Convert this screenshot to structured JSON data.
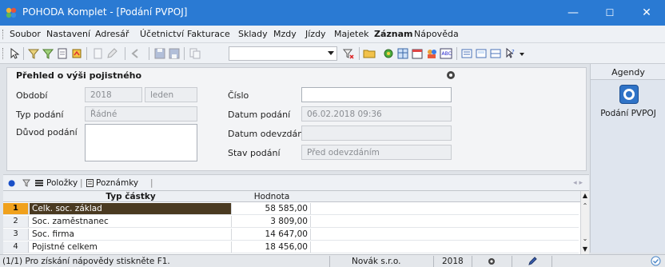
{
  "window": {
    "title": "POHODA Komplet - [Podání PVPOJ]",
    "minimize": "—",
    "maximize": "☐",
    "close": "✕"
  },
  "menu": {
    "items": [
      "Soubor",
      "Nastavení",
      "Adresář",
      "Účetnictví",
      "Fakturace",
      "Sklady",
      "Mzdy",
      "Jízdy",
      "Majetek",
      "Záznam",
      "Nápověda"
    ]
  },
  "form": {
    "title": "Přehled o výši pojistného",
    "obdobi_label": "Období",
    "obdobi_year": "2018",
    "obdobi_month": "leden",
    "typ_label": "Typ podání",
    "typ_value": "Řádné",
    "duvod_label": "Důvod podání",
    "duvod_value": "",
    "cislo_label": "Číslo",
    "cislo_value": "",
    "datum_podani_label": "Datum podání",
    "datum_podani_value": "06.02.2018 09:36",
    "datum_odevzdani_label": "Datum odevzdání",
    "datum_odevzdani_value": "",
    "stav_label": "Stav podání",
    "stav_value": "Před odevzdáním"
  },
  "agenda": {
    "header": "Agendy",
    "item_label": "Podání PVPOJ"
  },
  "tabs": {
    "polozky": "Položky",
    "poznamky": "Poznámky"
  },
  "grid": {
    "col_typ": "Typ částky",
    "col_hodnota": "Hodnota",
    "rows": [
      {
        "num": "1",
        "name": "Celk. soc. základ",
        "value": "58 585,00"
      },
      {
        "num": "2",
        "name": "Soc. zaměstnanec",
        "value": "3 809,00"
      },
      {
        "num": "3",
        "name": "Soc. firma",
        "value": "14 647,00"
      },
      {
        "num": "4",
        "name": "Pojistné celkem",
        "value": "18 456,00"
      }
    ]
  },
  "status": {
    "help": "(1/1) Pro získání nápovědy stiskněte F1.",
    "company": "Novák s.r.o.",
    "year": "2018"
  },
  "colors": {
    "titlebar": "#2a7ad3",
    "selected_row_num": "#f0a11c",
    "selected_row": "#4a3a21"
  }
}
